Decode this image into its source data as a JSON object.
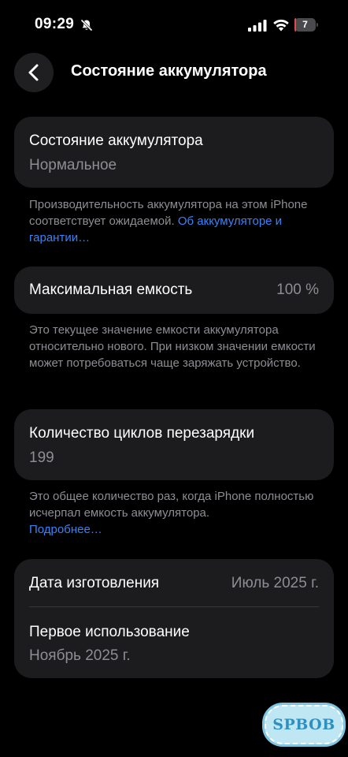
{
  "status_bar": {
    "time": "09:29",
    "battery_level": "7",
    "battery_fraction": 0.07,
    "icons": [
      "bell-off-icon",
      "cellular-signal-icon",
      "wifi-icon",
      "battery-icon"
    ]
  },
  "nav": {
    "back_icon": "chevron-left-icon",
    "title": "Состояние аккумулятора"
  },
  "health_card": {
    "label": "Состояние аккумулятора",
    "value": "Нормальное"
  },
  "health_note": {
    "text": "Производительность аккумулятора на этом iPhone соответствует ожидаемой.",
    "link": "Об аккумуляторе и гарантии…"
  },
  "capacity_card": {
    "label": "Максимальная емкость",
    "value": "100 %"
  },
  "capacity_note": {
    "text": "Это текущее значение емкости аккумулятора относительно нового. При низком значении емкости может потребоваться чаще заряжать устройство."
  },
  "cycles_card": {
    "label": "Количество циклов перезарядки",
    "value": "199"
  },
  "cycles_note": {
    "text": "Это общее количество раз, когда iPhone полностью исчерпал емкость аккумулятора.",
    "link": "Подробнее…"
  },
  "dates_card": {
    "manufacture_label": "Дата изготовления",
    "manufacture_value": "Июль 2025 г.",
    "first_use_label": "Первое использование",
    "first_use_value": "Ноябрь 2025 г."
  },
  "watermark": {
    "text": "SPBOB"
  },
  "colors": {
    "background": "#000000",
    "card": "#1c1c1e",
    "secondary_text": "#8d8d93",
    "link": "#3b82f6",
    "battery_low": "#e5484d"
  }
}
